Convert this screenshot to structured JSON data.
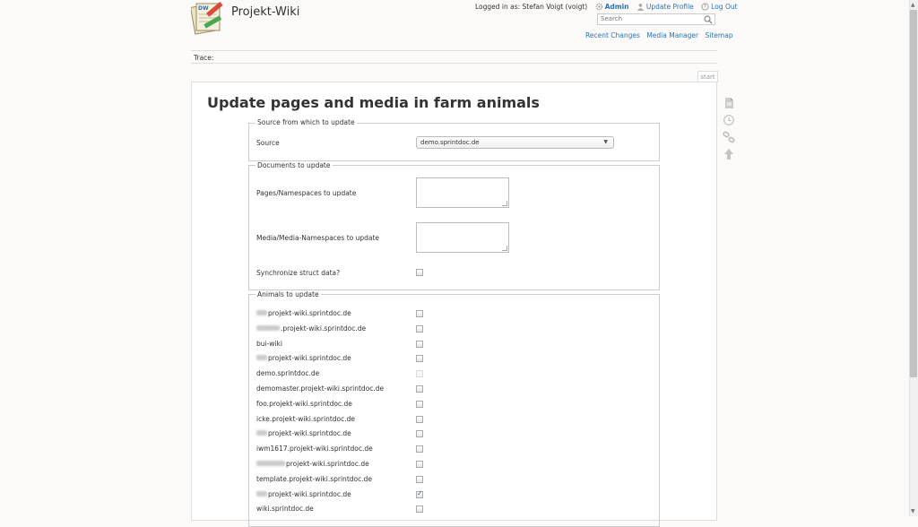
{
  "site": {
    "title": "Projekt-Wiki"
  },
  "user": {
    "logged_in_text": "Logged in as: Stefan Voigt (voigt)",
    "admin_label": "Admin",
    "update_profile_label": "Update Profile",
    "logout_label": "Log Out"
  },
  "search": {
    "placeholder": "Search"
  },
  "header_links": {
    "recent_changes": "Recent Changes",
    "media_manager": "Media Manager",
    "sitemap": "Sitemap"
  },
  "trace": {
    "label": "Trace:"
  },
  "page_id": "start",
  "page_title": "Update pages and media in farm animals",
  "source_section": {
    "legend": "Source from which to update",
    "source_label": "Source",
    "source_value": "demo.sprintdoc.de"
  },
  "documents_section": {
    "legend": "Documents to update",
    "pages_label": "Pages/Namespaces to update",
    "media_label": "Media/Media-Namespaces to update",
    "sync_label": "Synchronize struct data?"
  },
  "animals_section": {
    "legend": "Animals to update",
    "items": [
      {
        "label": "projekt-wiki.sprintdoc.de",
        "redacted": 1,
        "checked": false,
        "disabled": false
      },
      {
        "label": ".projekt-wiki.sprintdoc.de",
        "redacted": 2,
        "checked": false,
        "disabled": false
      },
      {
        "label": "bui-wiki",
        "redacted": 0,
        "checked": false,
        "disabled": false
      },
      {
        "label": "projekt-wiki.sprintdoc.de",
        "redacted": 1,
        "checked": false,
        "disabled": false
      },
      {
        "label": "demo.sprintdoc.de",
        "redacted": 0,
        "checked": false,
        "disabled": true
      },
      {
        "label": "demomaster.projekt-wiki.sprintdoc.de",
        "redacted": 0,
        "checked": false,
        "disabled": false
      },
      {
        "label": "foo.projekt-wiki.sprintdoc.de",
        "redacted": 0,
        "checked": false,
        "disabled": false
      },
      {
        "label": "icke.projekt-wiki.sprintdoc.de",
        "redacted": 0,
        "checked": false,
        "disabled": false
      },
      {
        "label": "projekt-wiki.sprintdoc.de",
        "redacted": 1,
        "checked": false,
        "disabled": false
      },
      {
        "label": "iwm1617.projekt-wiki.sprintdoc.de",
        "redacted": 0,
        "checked": false,
        "disabled": false
      },
      {
        "label": "projekt-wiki.sprintdoc.de",
        "redacted": 3,
        "checked": false,
        "disabled": false
      },
      {
        "label": "template.projekt-wiki.sprintdoc.de",
        "redacted": 0,
        "checked": false,
        "disabled": false
      },
      {
        "label": "projekt-wiki.sprintdoc.de",
        "redacted": 1,
        "checked": true,
        "disabled": false
      },
      {
        "label": "wiki.sprintdoc.de",
        "redacted": 0,
        "checked": false,
        "disabled": false
      }
    ]
  },
  "tools": [
    "show-source-icon",
    "old-revisions-icon",
    "backlinks-icon",
    "back-to-top-icon"
  ]
}
